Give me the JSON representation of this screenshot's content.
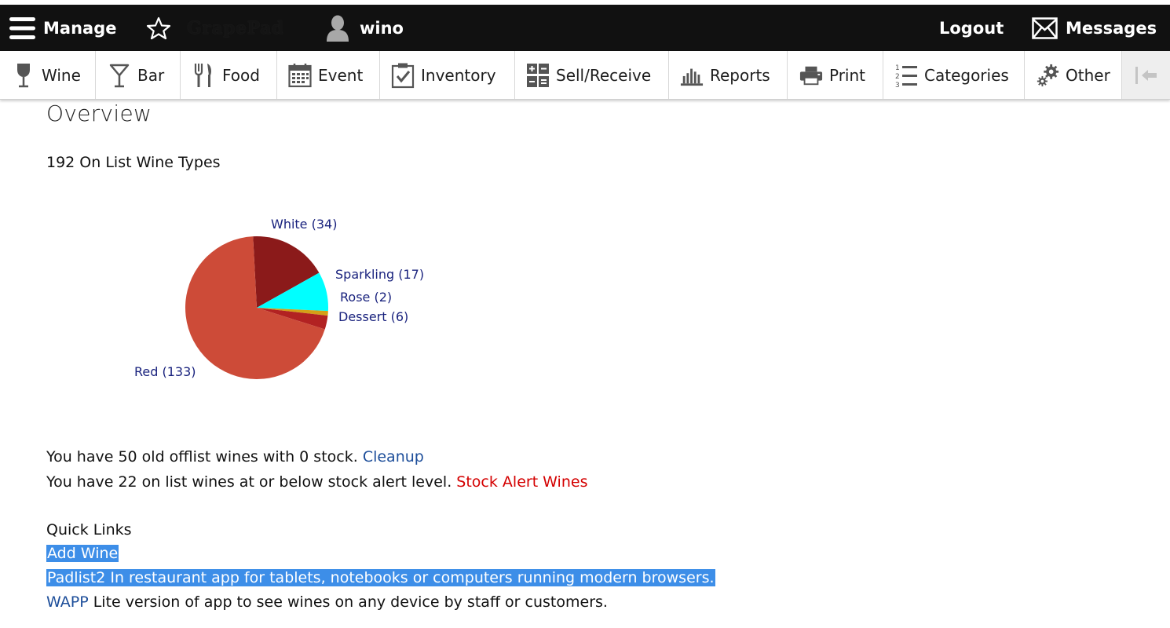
{
  "topbar": {
    "manage_label": "Manage",
    "brand": "GrapePad",
    "user_name": "wino",
    "logout_label": "Logout",
    "messages_label": "Messages"
  },
  "nav": {
    "wine": "Wine",
    "bar": "Bar",
    "food": "Food",
    "event": "Event",
    "inventory": "Inventory",
    "sell_receive": "Sell/Receive",
    "reports": "Reports",
    "print": "Print",
    "categories": "Categories",
    "other": "Other"
  },
  "overview": {
    "title": "Overview",
    "wine_types": "192 On List Wine Types",
    "offlist_text": "You have 50 old offlist wines with 0 stock.",
    "cleanup_link": "Cleanup",
    "stock_text": "You have 22 on list wines at or below stock alert level.",
    "stock_alert_link": "Stock Alert Wines"
  },
  "quick_links": {
    "heading": "Quick Links",
    "add_wine": "Add Wine",
    "padlist2": "Padlist2 In restaurant app for tablets, notebooks or computers running modern browsers.",
    "wapp_link": "WAPP",
    "wapp_desc": "Lite version of app to see wines on any device by staff or customers."
  },
  "chart_data": {
    "type": "pie",
    "labels": [
      "White (34)",
      "Sparkling (17)",
      "Rose (2)",
      "Dessert (6)",
      "Red (133)"
    ],
    "categories": [
      "White",
      "Sparkling",
      "Rose",
      "Dessert",
      "Red"
    ],
    "values": [
      34,
      17,
      2,
      6,
      133
    ],
    "colors": [
      "#8b1a1a",
      "#00ffff",
      "#d4a017",
      "#b22222",
      "#cd4b38"
    ]
  }
}
